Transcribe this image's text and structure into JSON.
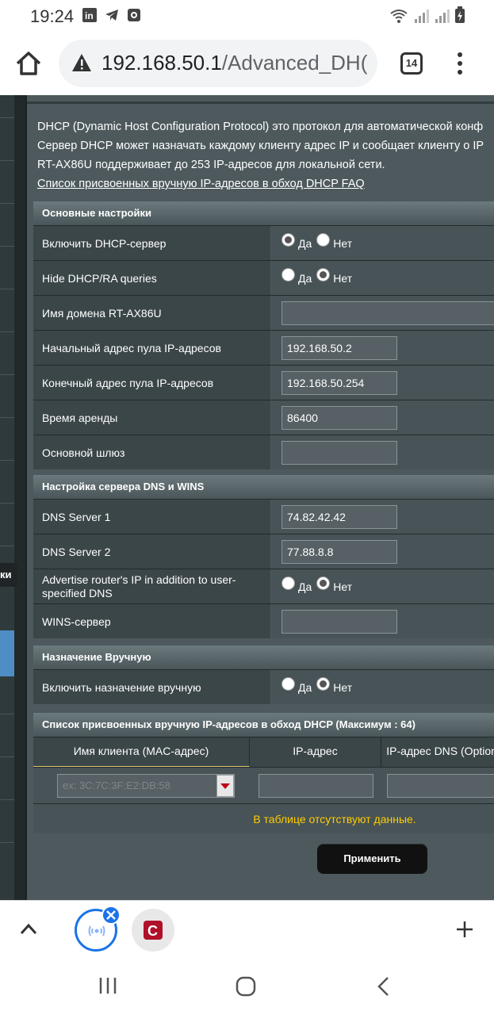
{
  "status": {
    "time": "19:24"
  },
  "browser": {
    "url_host": "192.168.50.1",
    "url_path": "/Advanced_DH(",
    "tab_count": "14"
  },
  "left_panel": {
    "label": "ки"
  },
  "description": {
    "line1": "DHCP (Dynamic Host Configuration Protocol) это протокол для автоматической конф",
    "line2": "Сервер DHCP может назначать каждому клиенту адрес IP и сообщает клиенту о IP",
    "line3": "RT-AX86U поддерживает до 253 IP-адресов для локальной сети.",
    "faq_link": "Список присвоенных вручную IP-адресов в обход DHCP FAQ"
  },
  "basic": {
    "title": "Основные настройки",
    "dhcp_enable_label": "Включить DHCP-сервер",
    "hide_dhcp_label": "Hide DHCP/RA queries",
    "domain_label": "Имя домена RT-AX86U",
    "domain_value": "",
    "start_label": "Начальный адрес пула IP-адресов",
    "start_value": "192.168.50.2",
    "end_label": "Конечный адрес пула IP-адресов",
    "end_value": "192.168.50.254",
    "lease_label": "Время аренды",
    "lease_value": "86400",
    "gateway_label": "Основной шлюз",
    "gateway_value": ""
  },
  "radio": {
    "yes": "Да",
    "no": "Нет"
  },
  "dns": {
    "title": "Настройка сервера DNS и WINS",
    "dns1_label": "DNS Server 1",
    "dns1_value": "74.82.42.42",
    "dns2_label": "DNS Server 2",
    "dns2_value": "77.88.8.8",
    "advertise_label": "Advertise router's IP in addition to user-specified DNS",
    "wins_label": "WINS-сервер",
    "wins_value": ""
  },
  "manual": {
    "title": "Назначение Вручную",
    "enable_label": "Включить назначение вручную"
  },
  "list": {
    "title": "Список присвоенных вручную IP-адресов в обход DHCP (Максимум : 64)",
    "col_client": "Имя клиента (MAC-адрес)",
    "col_ip": "IP-адрес",
    "col_dns": "IP-адрес DNS (Optiona",
    "mac_placeholder": "ex: 3C:7C:3F:E2:DB:58",
    "empty": "В таблице отсутствуют данные."
  },
  "apply_label": "Применить",
  "states": {
    "dhcp_enable": "yes",
    "hide_dhcp": "no",
    "advertise": "no",
    "manual_enable": "no"
  }
}
